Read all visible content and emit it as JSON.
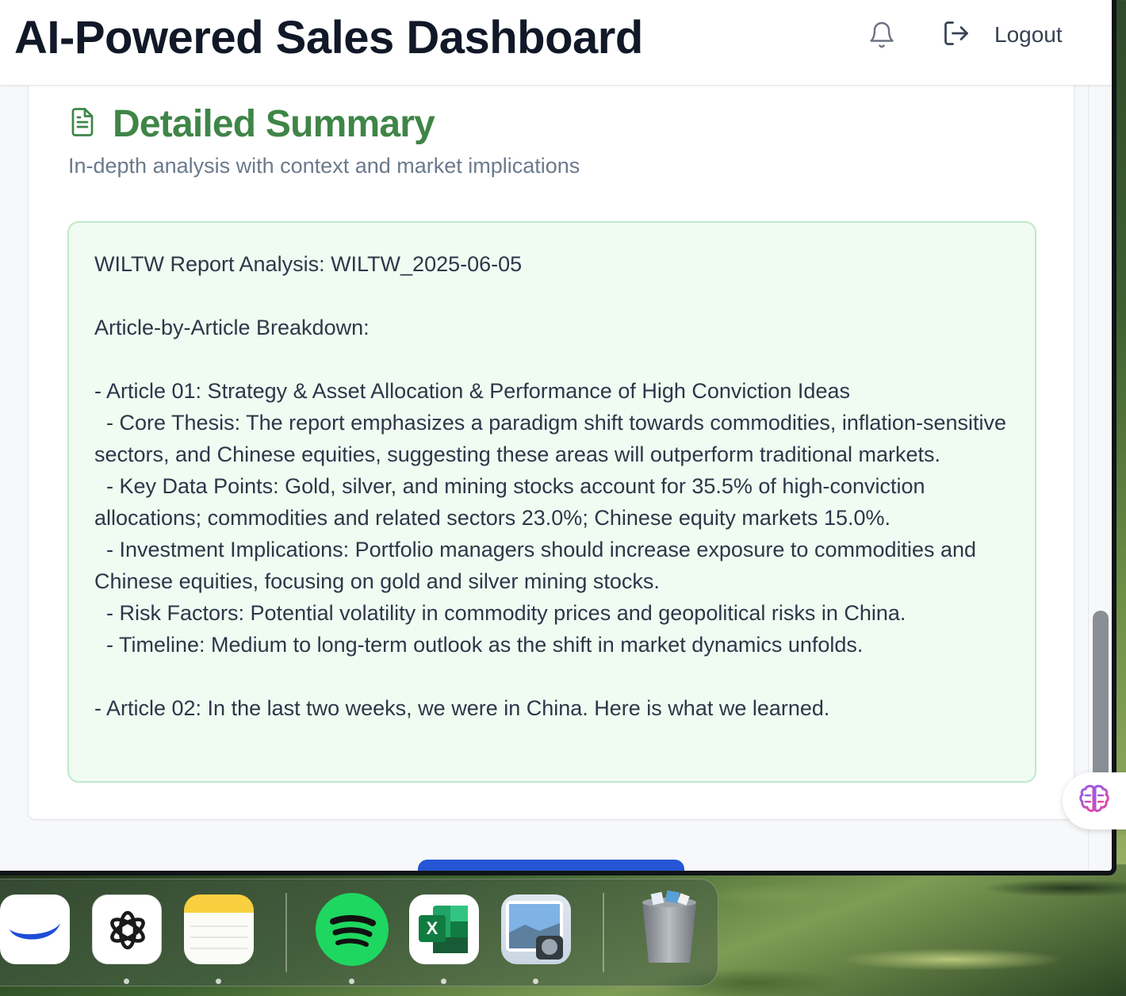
{
  "header": {
    "title": "AI-Powered Sales Dashboard",
    "logout_label": "Logout"
  },
  "summary_card": {
    "title": "Detailed Summary",
    "subtitle": "In-depth analysis with context and market implications",
    "body": "WILTW Report Analysis: WILTW_2025-06-05\n\nArticle-by-Article Breakdown:\n\n- Article 01: Strategy & Asset Allocation & Performance of High Conviction Ideas\n  - Core Thesis: The report emphasizes a paradigm shift towards commodities, inflation-sensitive sectors, and Chinese equities, suggesting these areas will outperform traditional markets.\n  - Key Data Points: Gold, silver, and mining stocks account for 35.5% of high-conviction allocations; commodities and related sectors 23.0%; Chinese equity markets 15.0%.\n  - Investment Implications: Portfolio managers should increase exposure to commodities and Chinese equities, focusing on gold and silver mining stocks.\n  - Risk Factors: Potential volatility in commodity prices and geopolitical risks in China.\n  - Timeline: Medium to long-term outlook as the shift in market dynamics unfolds.\n\n- Article 02: In the last two weeks, we were in China. Here is what we learned."
  },
  "colors": {
    "accent_green": "#3f8547",
    "summary_bg": "#f0fbf2",
    "summary_border": "#bfe9c8",
    "primary_blue": "#2456d6"
  },
  "icons": {
    "header": [
      "bell-icon",
      "logout-icon"
    ],
    "card": "document-icon",
    "floating": "brain-icon"
  },
  "dock": {
    "apps": [
      "wallet-app-icon",
      "chatgpt-app-icon",
      "notes-app-icon",
      "spotify-app-icon",
      "excel-app-icon",
      "preview-app-icon",
      "trash-icon"
    ],
    "excel_letter": "X"
  }
}
